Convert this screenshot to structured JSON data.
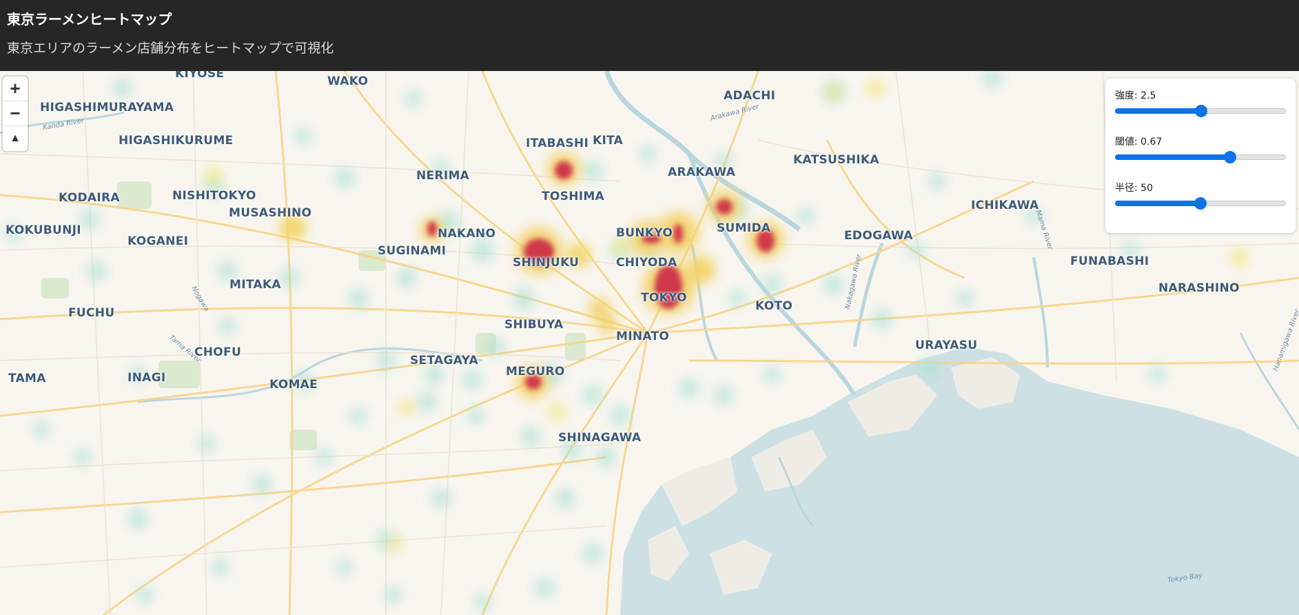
{
  "header": {
    "title": "東京ラーメンヒートマップ",
    "subtitle": "東京エリアのラーメン店舗分布をヒートマップで可視化"
  },
  "map_controls": {
    "zoom_in": "+",
    "zoom_out": "−",
    "compass": "▲"
  },
  "panel": {
    "intensity": {
      "label": "強度: 2.5",
      "value": 2.5,
      "min": 0,
      "max": 5
    },
    "threshold": {
      "label": "閾値: 0.67",
      "value": 0.67,
      "min": 0,
      "max": 1
    },
    "radius": {
      "label": "半径: 50",
      "value": 50,
      "min": 1,
      "max": 100
    }
  },
  "map_labels": [
    "KIYOSE",
    "WAKO",
    "ADACHI",
    "HIGASHIMURAYAMA",
    "HIGASHIKURUME",
    "ITABASHI",
    "KITA",
    "KATSUSHIKA",
    "NERIMA",
    "ARAKAWA",
    "KODAIRA",
    "NISHITOKYO",
    "TOSHIMA",
    "ICHIKAWA",
    "MUSASHINO",
    "KOKUBUNJI",
    "KOGANEI",
    "NAKANO",
    "BUNKYO",
    "SUMIDA",
    "EDOGAWA",
    "SUGINAMI",
    "SHINJUKU",
    "CHIYODA",
    "FUNABASHI",
    "MITAKA",
    "TOKYO",
    "NARASHINO",
    "KOTO",
    "FUCHU",
    "SHIBUYA",
    "MINATO",
    "URAYASU",
    "CHOFU",
    "SETAGAYA",
    "MEGURO",
    "TAMA",
    "INAGI",
    "KOMAE",
    "SHINAGAWA"
  ],
  "water_labels": [
    "Arakawa River",
    "Kanda River",
    "Nogawa",
    "Tama River",
    "Nakagawa River",
    "Mama River",
    "Hanamigawa River",
    "Tokyo Bay"
  ],
  "colors": {
    "header_bg": "#262626",
    "slider_accent": "#0d73e8",
    "water": "#cde1e5",
    "road": "#f6d68a",
    "hot": "#d0384b"
  }
}
